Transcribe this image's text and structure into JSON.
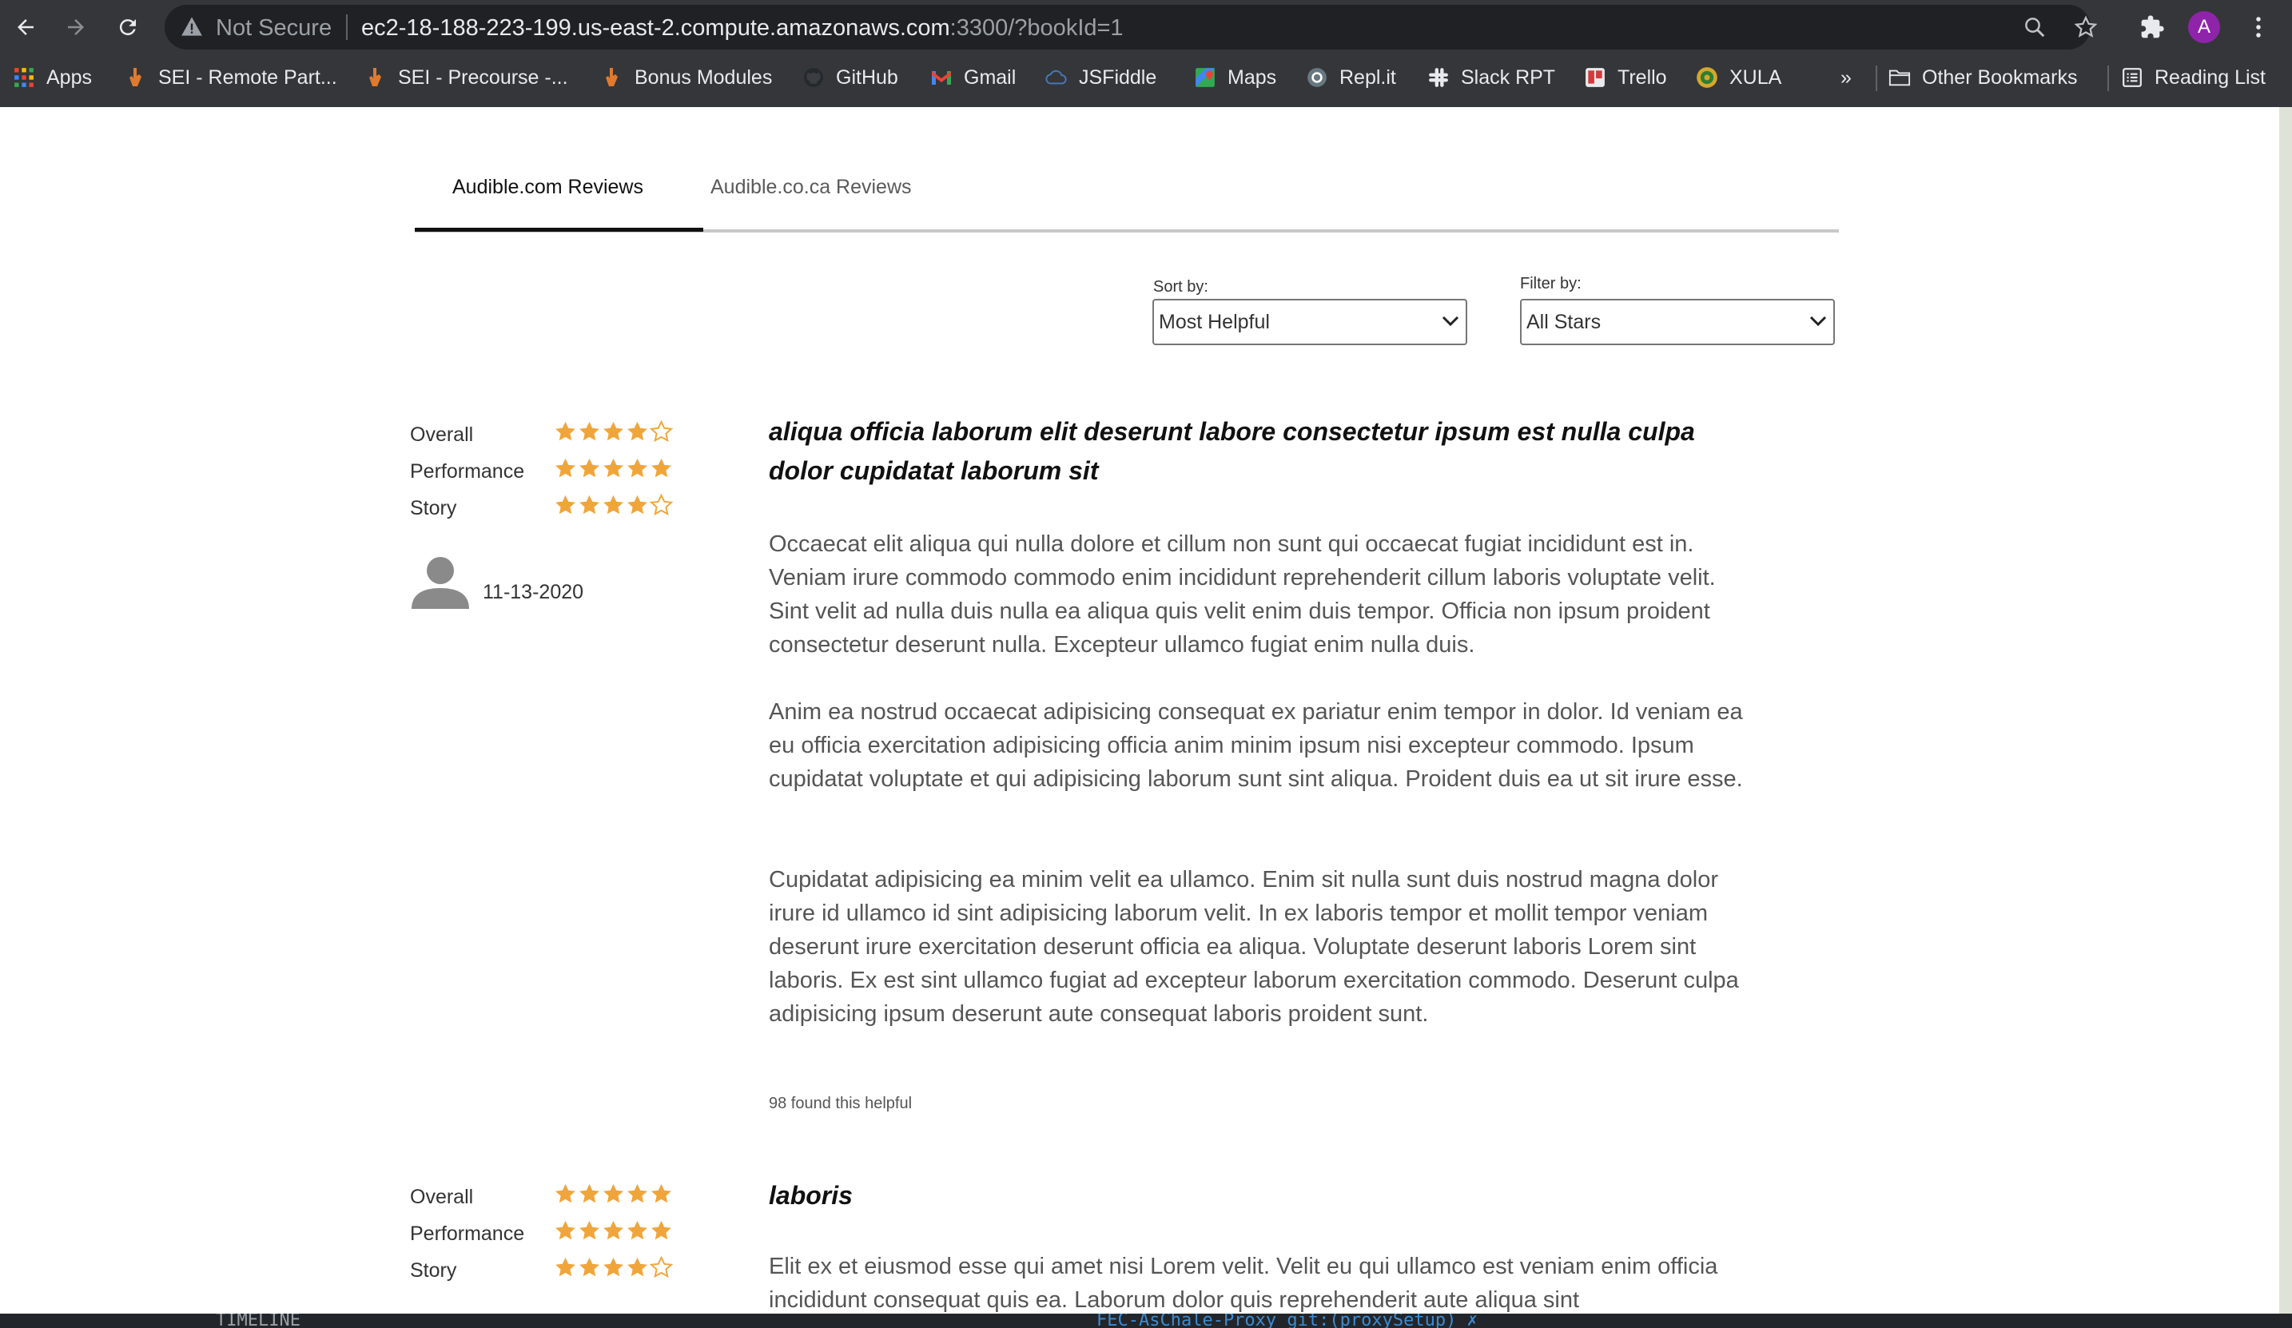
{
  "browser": {
    "security_label": "Not Secure",
    "url_host": "ec2-18-188-223-199.us-east-2.compute.amazonaws.com",
    "url_rest": ":3300/?bookId=1",
    "avatar_initial": "A",
    "overflow_label": "»",
    "bookmarks": [
      {
        "label": "Apps",
        "icon": "apps-grid-icon"
      },
      {
        "label": "SEI - Remote Part...",
        "icon": "ga-hand-icon"
      },
      {
        "label": "SEI - Precourse -...",
        "icon": "ga-hand-icon"
      },
      {
        "label": "Bonus Modules",
        "icon": "ga-hand-icon"
      },
      {
        "label": "GitHub",
        "icon": "github-icon"
      },
      {
        "label": "Gmail",
        "icon": "gmail-icon"
      },
      {
        "label": "JSFiddle",
        "icon": "jsfiddle-icon"
      },
      {
        "label": "Maps",
        "icon": "maps-icon"
      },
      {
        "label": "Repl.it",
        "icon": "replit-icon"
      },
      {
        "label": "Slack RPT",
        "icon": "slack-icon"
      },
      {
        "label": "Trello",
        "icon": "trello-icon"
      },
      {
        "label": "XULA",
        "icon": "xula-icon"
      }
    ],
    "other_bookmarks": "Other Bookmarks",
    "reading_list": "Reading List"
  },
  "tabs": [
    {
      "label": "Audible.com Reviews",
      "active": true
    },
    {
      "label": "Audible.co.ca Reviews",
      "active": false
    }
  ],
  "controls": {
    "sort_label": "Sort by:",
    "sort_value": "Most Helpful",
    "filter_label": "Filter by:",
    "filter_value": "All Stars"
  },
  "reviews": [
    {
      "ratings": [
        {
          "label": "Overall",
          "stars": 4
        },
        {
          "label": "Performance",
          "stars": 5
        },
        {
          "label": "Story",
          "stars": 4
        }
      ],
      "date": "11-13-2020",
      "title": "aliqua officia laborum elit deserunt labore consectetur ipsum est nulla culpa dolor cupidatat laborum sit",
      "paragraphs": [
        "Occaecat elit aliqua qui nulla dolore et cillum non sunt qui occaecat fugiat incididunt est in. Veniam irure commodo commodo enim incididunt reprehenderit cillum laboris voluptate velit. Sint velit ad nulla duis nulla ea aliqua quis velit enim duis tempor. Officia non ipsum proident consectetur deserunt nulla. Excepteur ullamco fugiat enim nulla duis.",
        "Anim ea nostrud occaecat adipisicing consequat ex pariatur enim tempor in dolor. Id veniam ea eu officia exercitation adipisicing officia anim minim ipsum nisi excepteur commodo. Ipsum cupidatat voluptate et qui adipisicing laborum sunt sint aliqua. Proident duis ea ut sit irure esse.",
        "Cupidatat adipisicing ea minim velit ea ullamco. Enim sit nulla sunt duis nostrud magna dolor irure id ullamco id sint adipisicing laborum velit. In ex laboris tempor et mollit tempor veniam deserunt irure exercitation deserunt officia ea aliqua. Voluptate deserunt laboris Lorem sint laboris. Ex est sint ullamco fugiat ad excepteur laborum exercitation commodo. Deserunt culpa adipisicing ipsum deserunt aute consequat laboris proident sunt."
      ],
      "helpful": "98 found this helpful"
    },
    {
      "ratings": [
        {
          "label": "Overall",
          "stars": 5
        },
        {
          "label": "Performance",
          "stars": 5
        },
        {
          "label": "Story",
          "stars": 4
        }
      ],
      "title": "laboris",
      "paragraphs": [
        "Elit ex et eiusmod esse qui amet nisi Lorem velit. Velit eu qui ullamco est veniam enim officia incididunt consequat quis ea. Laborum dolor quis reprehenderit aute aliqua sint"
      ]
    }
  ],
  "taskbar": {
    "left_text": "TIMELINE",
    "mid_text": "FEC-AsChale-Proxy git:(proxySetup) ✗"
  },
  "colors": {
    "star": "#f0a53b",
    "chrome_bg": "#353639",
    "omnibox_bg": "#202124"
  }
}
